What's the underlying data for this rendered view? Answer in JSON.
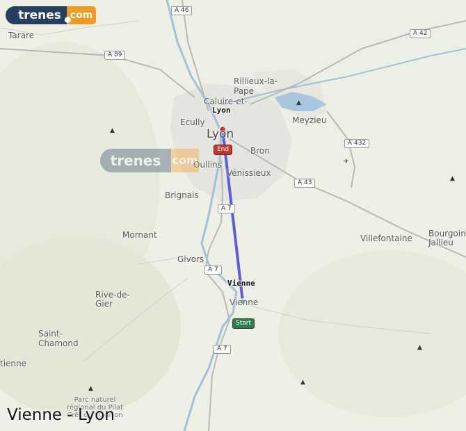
{
  "brand": {
    "name": "trenes",
    "suffix": "com",
    "colors": {
      "navy": "#25405f",
      "orange": "#f29a1f"
    }
  },
  "route": {
    "title": "Vienne - Lyon",
    "origin": {
      "name": "Vienne",
      "marker_label": "Start",
      "marker_color": "#2e7d4f"
    },
    "destination": {
      "name": "Lyon",
      "marker_label": "End",
      "marker_color": "#c0392b"
    },
    "line_color": "#5a5ce8"
  },
  "places": {
    "tarare": "Tarare",
    "lyon": "Lyon",
    "rillieux": "Rillieux-la-\nPape",
    "caluire": "Caluire-et-",
    "ecully": "Ecully",
    "meyzieu": "Meyzieu",
    "bron": "Bron",
    "oullins": "Oullins",
    "venissieux": "Vénissieux",
    "brignais": "Brignais",
    "mornant": "Mornant",
    "givors": "Givors",
    "villefontaine": "Villefontaine",
    "bourgoin": "Bourgoin-\nJallieu",
    "rive_de_gier": "Rive-de-\nGier",
    "vienne": "Vienne",
    "saint_chamond": "Saint-\nChamond",
    "etienne": "tienne",
    "parc": "Parc naturel\nrégional du Pilat\nCrêt de l'Oeillon"
  },
  "roads": {
    "a46": "A 46",
    "a42": "A 42",
    "a89": "A 89",
    "a432": "A 432",
    "a43": "A 43",
    "a7_north": "A 7",
    "a7_mid": "A 7",
    "a7_south": "A 7"
  }
}
